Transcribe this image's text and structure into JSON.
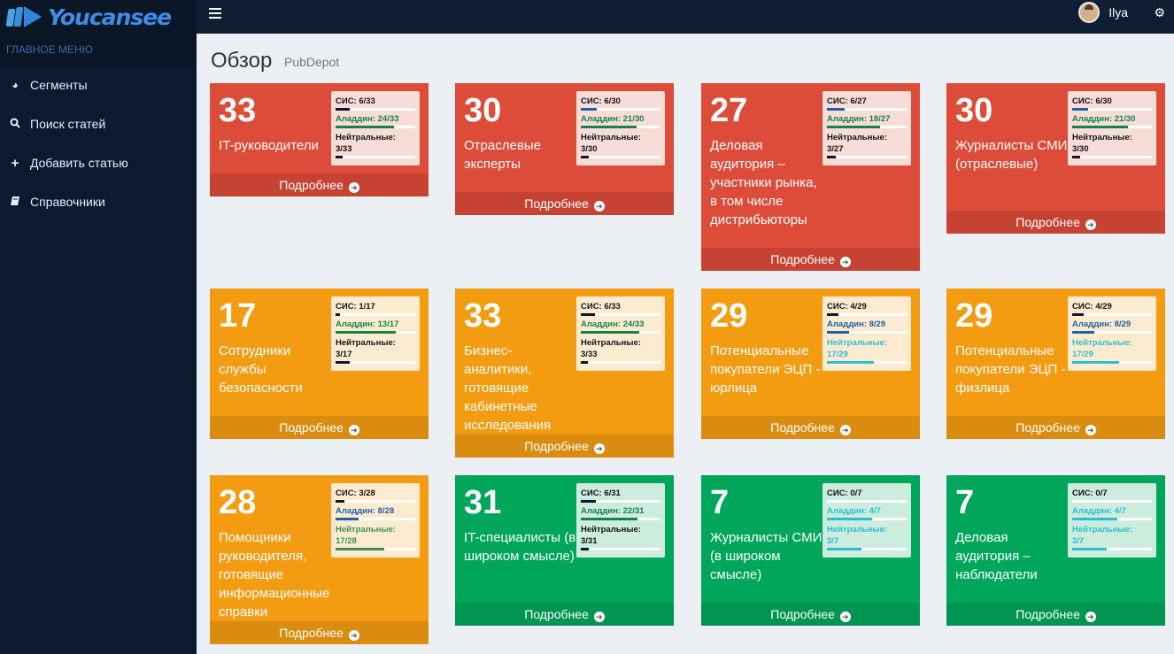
{
  "app": {
    "logo": "Youcansee",
    "user": "Ilya"
  },
  "sidebar": {
    "header": "ГЛАВНОЕ МЕНЮ",
    "items": [
      {
        "label": "Сегменты",
        "icon": "pie-chart-icon"
      },
      {
        "label": "Поиск статей",
        "icon": "search-icon"
      },
      {
        "label": "Добавить статью",
        "icon": "plus-icon"
      },
      {
        "label": "Справочники",
        "icon": "book-icon"
      }
    ]
  },
  "page": {
    "title": "Обзор",
    "subtitle": "PubDepot"
  },
  "colors": {
    "red": "#dd4b39",
    "orange": "#f39c12",
    "green": "#00a65a",
    "sidebar": "#0b1a30"
  },
  "cards": [
    {
      "number": "33",
      "label": "IT-руководители",
      "color": "red",
      "sis": "СИС: 6/33",
      "sis_v": 0.18,
      "sis_c": "dark",
      "aladdin": "Аладдин: 24/33",
      "aladdin_v": 0.73,
      "aladdin_c": "green",
      "neutral_label": "Нейтральные:",
      "neutral_value": "3/33",
      "neutral_v": 0.09,
      "neutral_c": "dark",
      "more": "Подробнее"
    },
    {
      "number": "30",
      "label": "Отраслевые эксперты",
      "color": "red",
      "sis": "СИС: 6/30",
      "sis_v": 0.2,
      "sis_c": "blue",
      "aladdin": "Аладдин: 21/30",
      "aladdin_v": 0.7,
      "aladdin_c": "green",
      "neutral_label": "Нейтральные:",
      "neutral_value": "3/30",
      "neutral_v": 0.1,
      "neutral_c": "dark",
      "more": "Подробнее"
    },
    {
      "number": "27",
      "label": "Деловая аудитория – участники рынка, в том числе дистрибьюторы",
      "color": "red",
      "sis": "СИС: 6/27",
      "sis_v": 0.22,
      "sis_c": "blue",
      "aladdin": "Аладдин: 18/27",
      "aladdin_v": 0.67,
      "aladdin_c": "green",
      "neutral_label": "Нейтральные:",
      "neutral_value": "3/27",
      "neutral_v": 0.11,
      "neutral_c": "dark",
      "more": "Подробнее"
    },
    {
      "number": "30",
      "label": "Журналисты СМИ (отраслевые)",
      "color": "red",
      "sis": "СИС: 6/30",
      "sis_v": 0.2,
      "sis_c": "blue",
      "aladdin": "Аладдин: 21/30",
      "aladdin_v": 0.7,
      "aladdin_c": "green",
      "neutral_label": "Нейтральные:",
      "neutral_value": "3/30",
      "neutral_v": 0.1,
      "neutral_c": "dark",
      "more": "Подробнее"
    },
    {
      "number": "17",
      "label": "Сотрудники службы безопасности",
      "color": "orange",
      "sis": "СИС: 1/17",
      "sis_v": 0.06,
      "sis_c": "dark",
      "aladdin": "Аладдин: 13/17",
      "aladdin_v": 0.76,
      "aladdin_c": "green",
      "neutral_label": "Нейтральные:",
      "neutral_value": "3/17",
      "neutral_v": 0.18,
      "neutral_c": "dark",
      "more": "Подробнее"
    },
    {
      "number": "33",
      "label": "Бизнес-аналитики, готовящие кабинетные исследования",
      "color": "orange",
      "sis": "СИС: 6/33",
      "sis_v": 0.18,
      "sis_c": "dark",
      "aladdin": "Аладдин: 24/33",
      "aladdin_v": 0.73,
      "aladdin_c": "green",
      "neutral_label": "Нейтральные:",
      "neutral_value": "3/33",
      "neutral_v": 0.09,
      "neutral_c": "dark",
      "more": "Подробнее"
    },
    {
      "number": "29",
      "label": "Потенциальные покупатели ЭЦП - юрлица",
      "color": "orange",
      "sis": "СИС: 4/29",
      "sis_v": 0.14,
      "sis_c": "dark",
      "aladdin": "Аладдин: 8/29",
      "aladdin_v": 0.28,
      "aladdin_c": "blue",
      "neutral_label": "Нейтральные:",
      "neutral_value": "17/29",
      "neutral_v": 0.59,
      "neutral_c": "teal",
      "more": "Подробнее"
    },
    {
      "number": "29",
      "label": "Потенциальные покупатели ЭЦП - физлица",
      "color": "orange",
      "sis": "СИС: 4/29",
      "sis_v": 0.14,
      "sis_c": "dark",
      "aladdin": "Аладдин: 8/29",
      "aladdin_v": 0.28,
      "aladdin_c": "blue",
      "neutral_label": "Нейтральные:",
      "neutral_value": "17/29",
      "neutral_v": 0.59,
      "neutral_c": "teal",
      "more": "Подробнее"
    },
    {
      "number": "28",
      "label": "Помощники руководителя, готовящие информационные справки",
      "color": "orange",
      "sis": "СИС: 3/28",
      "sis_v": 0.11,
      "sis_c": "dark",
      "aladdin": "Аладдин: 8/28",
      "aladdin_v": 0.29,
      "aladdin_c": "blue",
      "neutral_label": "Нейтральные:",
      "neutral_value": "17/28",
      "neutral_v": 0.61,
      "neutral_c": "olive",
      "more": "Подробнее"
    },
    {
      "number": "31",
      "label": "IT-специалисты (в широком смысле)",
      "color": "green",
      "sis": "СИС: 6/31",
      "sis_v": 0.19,
      "sis_c": "dark",
      "aladdin": "Аладдин: 22/31",
      "aladdin_v": 0.71,
      "aladdin_c": "green",
      "neutral_label": "Нейтральные:",
      "neutral_value": "3/31",
      "neutral_v": 0.1,
      "neutral_c": "dark",
      "more": "Подробнее"
    },
    {
      "number": "7",
      "label": "Журналисты СМИ (в широком смысле)",
      "color": "green",
      "sis": "СИС: 0/7",
      "sis_v": 0.0,
      "sis_c": "dark",
      "aladdin": "Аладдин: 4/7",
      "aladdin_v": 0.57,
      "aladdin_c": "teal",
      "neutral_label": "Нейтральные:",
      "neutral_value": "3/7",
      "neutral_v": 0.43,
      "neutral_c": "teal",
      "more": "Подробнее"
    },
    {
      "number": "7",
      "label": "Деловая аудитория – наблюдатели",
      "color": "green",
      "sis": "СИС: 0/7",
      "sis_v": 0.0,
      "sis_c": "dark",
      "aladdin": "Аладдин: 4/7",
      "aladdin_v": 0.57,
      "aladdin_c": "teal",
      "neutral_label": "Нейтральные:",
      "neutral_value": "3/7",
      "neutral_v": 0.43,
      "neutral_c": "teal",
      "more": "Подробнее"
    }
  ]
}
